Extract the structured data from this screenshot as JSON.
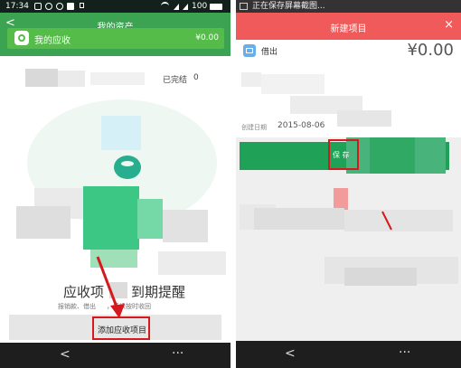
{
  "left": {
    "status": {
      "time": "17:34",
      "battery": "100"
    },
    "header": {
      "back": "<",
      "title": "我的资产"
    },
    "card": {
      "title": "我的应收",
      "amount": "¥0.00"
    },
    "tab_partial": "已完结",
    "tab_count": "0",
    "empty": {
      "title_start": "应收项",
      "title_end": "到期提醒",
      "subtitle_start": "报销款、借出",
      "subtitle_end": "，续续按时收回"
    },
    "add_button": "添加应收项目",
    "nav": {
      "back": "<",
      "menu": "···"
    }
  },
  "right": {
    "status": {
      "text": "正在保存屏幕截图..."
    },
    "header": {
      "title": "新建项目",
      "close": "×"
    },
    "form": {
      "type_label": "借出",
      "amount": "¥0.00",
      "date_label": "创建日期",
      "date_value": "2015-08-06"
    },
    "save_button": "保 存",
    "nav": {
      "back": "<",
      "menu": "···"
    }
  },
  "colors": {
    "green": "#3cb44a",
    "red_header": "#f15a5a",
    "highlight": "#d6191d"
  }
}
